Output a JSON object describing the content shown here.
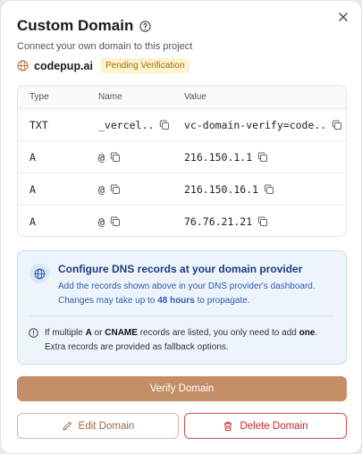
{
  "modal": {
    "title": "Custom Domain",
    "subtitle": "Connect your own domain to this project",
    "icons": {
      "close": "close-icon",
      "help": "help-circle-icon"
    }
  },
  "domain": {
    "name": "codepup.ai",
    "status": "Pending Verification",
    "icon": "globe-icon"
  },
  "dns_table": {
    "headers": {
      "type": "Type",
      "name": "Name",
      "value": "Value"
    },
    "rows": [
      {
        "type": "TXT",
        "name": "_vercel..",
        "value": "vc-domain-verify=code.."
      },
      {
        "type": "A",
        "name": "@",
        "value": "216.150.1.1"
      },
      {
        "type": "A",
        "name": "@",
        "value": "216.150.16.1"
      },
      {
        "type": "A",
        "name": "@",
        "value": "76.76.21.21"
      }
    ]
  },
  "info": {
    "title": "Configure DNS records at your domain provider",
    "text_part1": "Add the records shown above in your DNS provider's dashboard. Changes may take up to ",
    "text_bold": "48 hours",
    "text_part2": " to propagate.",
    "note_prefix": "If multiple ",
    "note_a": "A",
    "note_or": " or ",
    "note_cname": "CNAME",
    "note_mid": " records are listed, you only need to add ",
    "note_one": "one",
    "note_suffix": ". Extra records are provided as fallback options."
  },
  "actions": {
    "verify_label": "Verify Domain",
    "edit_label": "Edit Domain",
    "delete_label": "Delete Domain"
  },
  "colors": {
    "accent": "#c48e66",
    "danger": "#c62828",
    "badge_bg": "#fdf3cf",
    "badge_text": "#a86d00",
    "info_bg": "#eef4fc",
    "info_text": "#2f5bb0"
  }
}
